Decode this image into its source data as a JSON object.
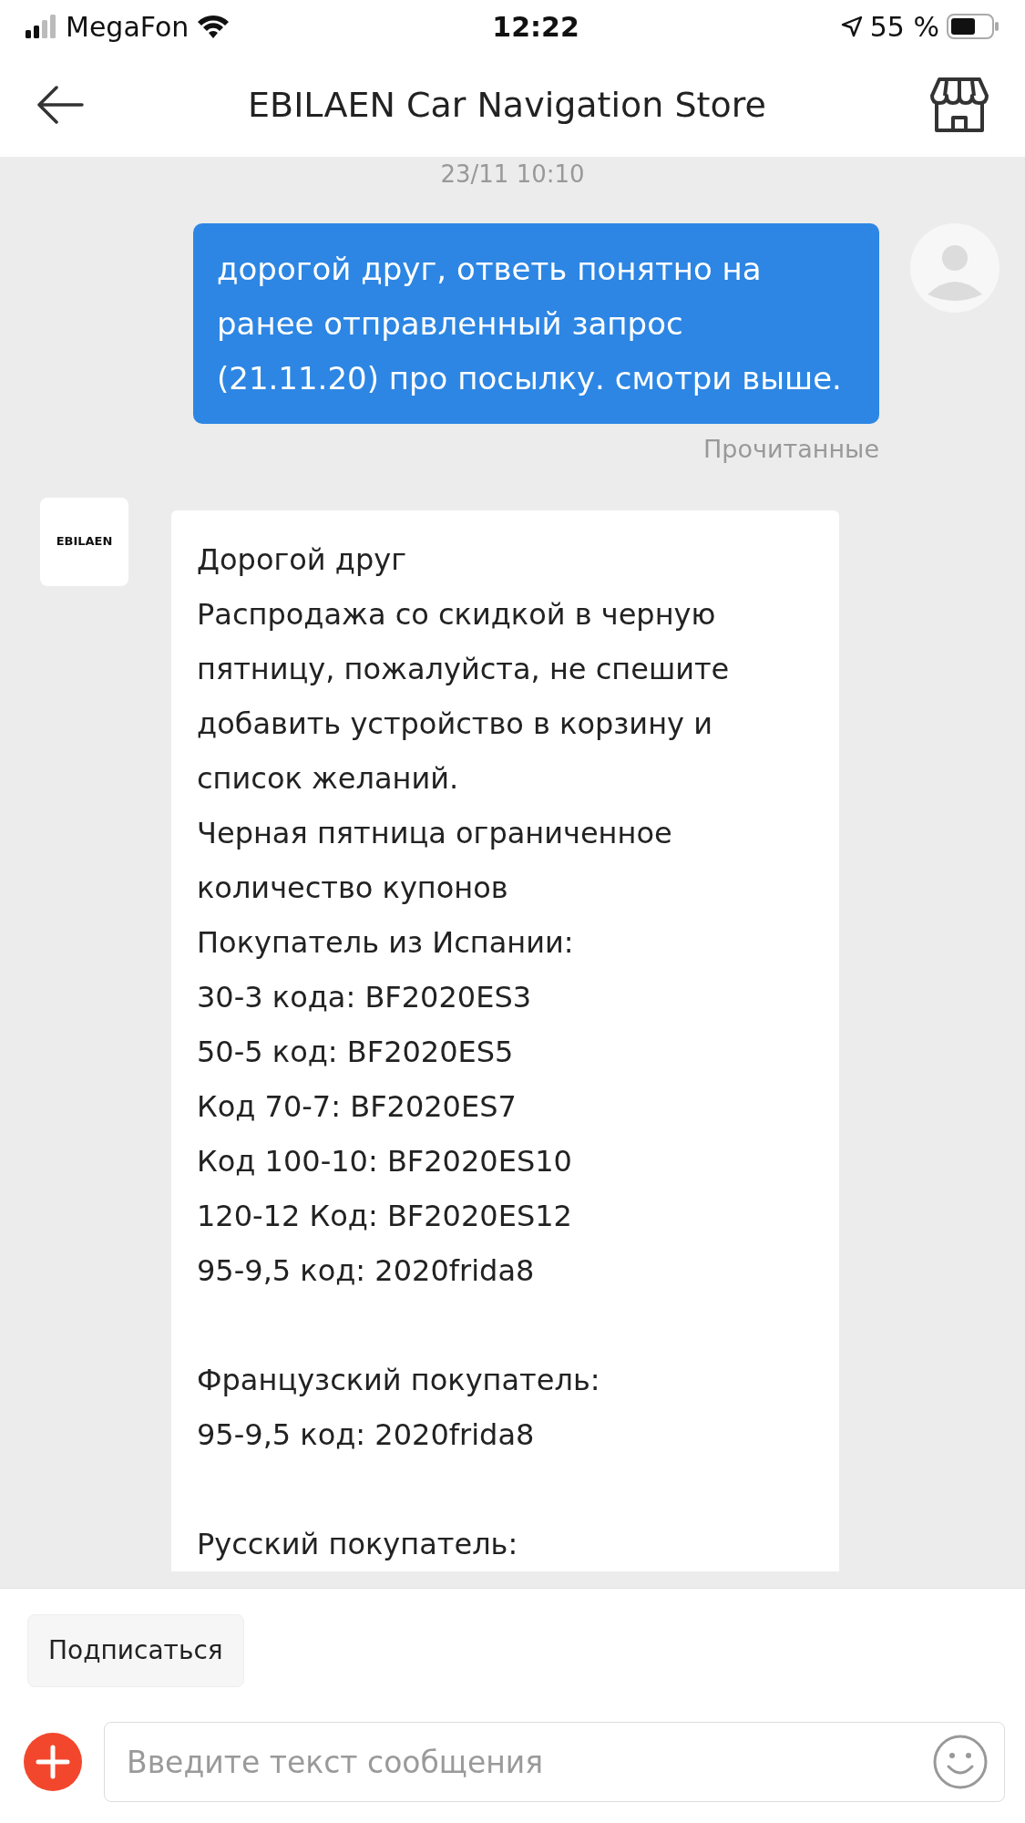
{
  "status_bar": {
    "carrier": "MegaFon",
    "time": "12:22",
    "battery": "55 %"
  },
  "header": {
    "title": "EBILAEN Car Navigation Store"
  },
  "chat": {
    "timestamp": "23/11 10:10",
    "messages": [
      {
        "kind": "outgoing",
        "text": "дорогой друг, ответь понятно на ранее отправленный запрос (21.11.20) про посылку. смотри выше.",
        "receipt": "Прочитанные"
      },
      {
        "kind": "incoming",
        "sender_logo": "EBILAEN",
        "paragraphs": [
          [
            "Дорогой друг",
            "Распродажа со скидкой в черную пятницу, пожалуйста, не спешите добавить устройство в корзину и список желаний.",
            "Черная пятница ограниченное количество купонов",
            "Покупатель из Испании:",
            "30-3 кода: BF2020ES3",
            "50-5 код: BF2020ES5",
            "Код 70-7: BF2020ES7",
            "Код 100-10: BF2020ES10",
            "120-12 Код: BF2020ES12",
            "95-9,5 код: 2020frida8"
          ],
          [
            "Французский покупатель:",
            "95-9,5 код: 2020frida8"
          ],
          [
            "Русский покупатель:"
          ]
        ]
      }
    ]
  },
  "footer": {
    "subscribe_button": "Подписаться",
    "input": {
      "placeholder": "Введите текст сообщения"
    }
  }
}
